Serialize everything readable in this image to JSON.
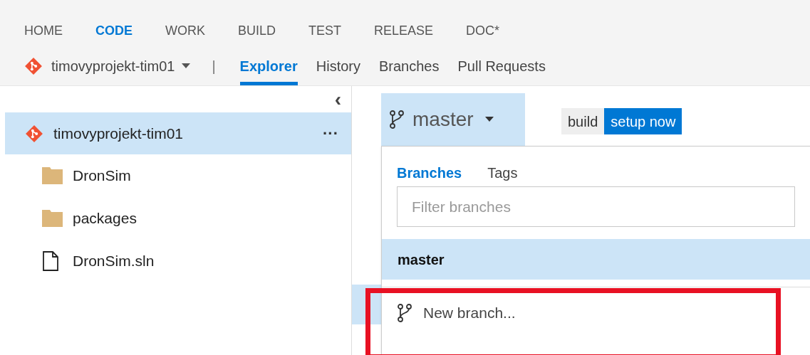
{
  "main_nav": [
    {
      "label": "HOME",
      "selected": false
    },
    {
      "label": "CODE",
      "selected": true
    },
    {
      "label": "WORK",
      "selected": false
    },
    {
      "label": "BUILD",
      "selected": false
    },
    {
      "label": "TEST",
      "selected": false
    },
    {
      "label": "RELEASE",
      "selected": false
    },
    {
      "label": "DOC*",
      "selected": false
    }
  ],
  "repo_selector": {
    "label": "timovyprojekt-tim01"
  },
  "separator": "|",
  "sub_nav": [
    {
      "label": "Explorer",
      "selected": true
    },
    {
      "label": "History",
      "selected": false
    },
    {
      "label": "Branches",
      "selected": false
    },
    {
      "label": "Pull Requests",
      "selected": false
    }
  ],
  "collapse_button": "‹",
  "tree": {
    "root": {
      "label": "timovyprojekt-tim01",
      "selected": true,
      "more": "···"
    },
    "children": [
      {
        "label": "DronSim",
        "kind": "folder"
      },
      {
        "label": "packages",
        "kind": "folder"
      },
      {
        "label": "DronSim.sln",
        "kind": "file"
      }
    ]
  },
  "branch_button": {
    "label": "master",
    "expanded": true
  },
  "build_badge": {
    "label": "build",
    "action": "setup now"
  },
  "branch_dropdown": {
    "tabs": [
      {
        "label": "Branches",
        "selected": true
      },
      {
        "label": "Tags",
        "selected": false
      }
    ],
    "filter": {
      "placeholder": "Filter branches"
    },
    "branches": [
      {
        "label": "master",
        "selected": true
      }
    ],
    "actions": [
      {
        "label": "New branch..."
      }
    ]
  },
  "highlight": {
    "on": true
  }
}
